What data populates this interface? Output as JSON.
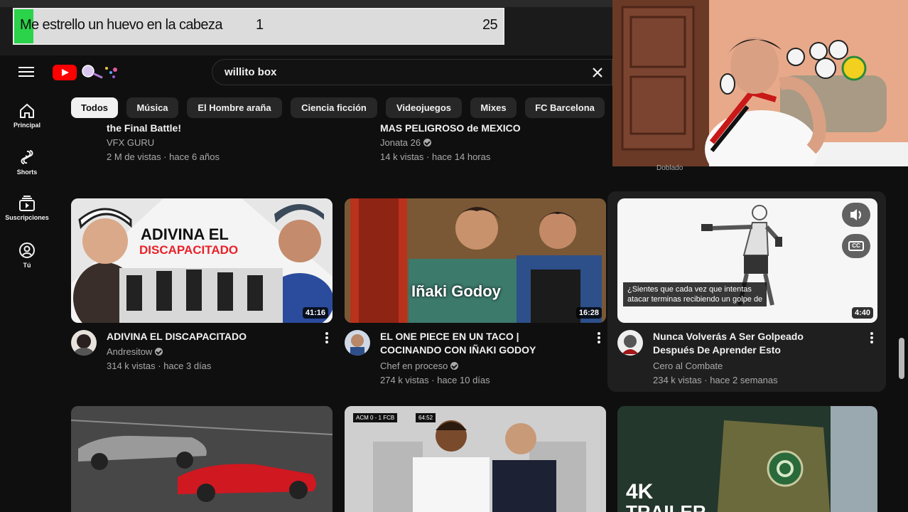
{
  "overlay": {
    "counter_text": "Me estrello un huevo en la cabeza",
    "counter_current": "1",
    "counter_goal": "25",
    "progress_fraction": 0.04
  },
  "masthead": {
    "search_query": "willito box"
  },
  "rail": [
    {
      "label": "Principal",
      "icon": "home-icon"
    },
    {
      "label": "Shorts",
      "icon": "shorts-icon"
    },
    {
      "label": "Suscripciones",
      "icon": "subscriptions-icon"
    },
    {
      "label": "Tú",
      "icon": "account-icon"
    }
  ],
  "chips": [
    "Todos",
    "Música",
    "El Hombre araña",
    "Ciencia ficción",
    "Videojuegos",
    "Mixes",
    "FC Barcelona"
  ],
  "previous_row": [
    {
      "title": "the Final Battle!",
      "channel": "VFX GURU",
      "stats": "2 M de vistas · hace 6 años"
    },
    {
      "title": "MAS PELIGROSO de MEXICO",
      "channel": "Jonata 26",
      "stats": "14 k vistas · hace 14 horas"
    }
  ],
  "videos": [
    {
      "thumb_text1": "ADIVINA EL",
      "thumb_text2": "DISCAPACITADO",
      "duration": "41:16",
      "title_line1": "ADIVINA EL DISCAPACITADO",
      "title_line2": "",
      "channel": "Andresitow",
      "stats": "314 k vistas · hace 3 días"
    },
    {
      "thumb_text1": "Iñaki Godoy",
      "duration": "16:28",
      "title_line1": "EL ONE PIECE EN UN TACO |",
      "title_line2": "COCINANDO CON IÑAKI GODOY",
      "channel": "Chef en proceso",
      "stats": "274 k vistas · hace 10 días"
    },
    {
      "caption_line1": "¿Sientes que cada vez que intentas",
      "caption_line2": "atacar terminas recibiendo un golpe de",
      "duration": "4:40",
      "cc_label": "CC",
      "title_line1": "Nunca Volverás A Ser Golpeado",
      "title_line2": "Después De Aprender Esto",
      "channel": "Cero al Combate",
      "stats": "234 k vistas · hace 2 semanas"
    }
  ],
  "next_row": {
    "scoreboard": "ACM 0 - 1 FCB",
    "clock": "64:52",
    "trailer_text1": "4K",
    "trailer_text2": "TRAILER"
  },
  "webcam": {
    "label": "Doblado"
  },
  "colors": {
    "background": "#0f0f0f",
    "chip": "#272727",
    "accent_red": "#ff0000",
    "progress_green": "#2bd34a"
  }
}
